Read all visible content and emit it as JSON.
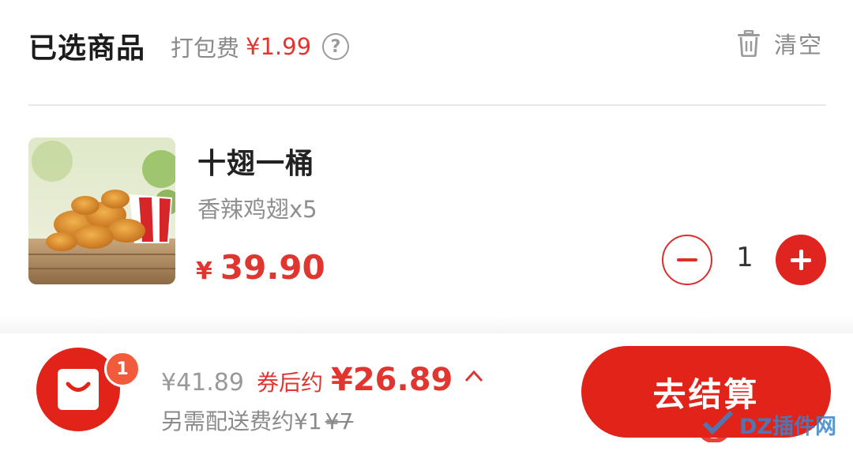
{
  "header": {
    "title": "已选商品",
    "pack_fee_label": "打包费",
    "pack_fee_price": "¥1.99",
    "help_icon": "?",
    "clear_label": "清空"
  },
  "cart": {
    "items": [
      {
        "name": "十翅一桶",
        "desc": "香辣鸡翅x5",
        "currency": "¥",
        "price": "39.90",
        "quantity": "1",
        "image": "fried-chicken-wings-bucket"
      }
    ]
  },
  "summary": {
    "badge_count": "1",
    "original_total": "¥41.89",
    "coupon_label": "券后约",
    "final_total": "¥26.89",
    "delivery_text": "另需配送费约¥1",
    "delivery_struck": "¥7",
    "checkout_label": "去结算"
  },
  "watermark": {
    "text": "DZ插件网"
  },
  "colors": {
    "accent": "#e2231a",
    "price": "#e1352f",
    "muted": "#8a8a8a"
  }
}
